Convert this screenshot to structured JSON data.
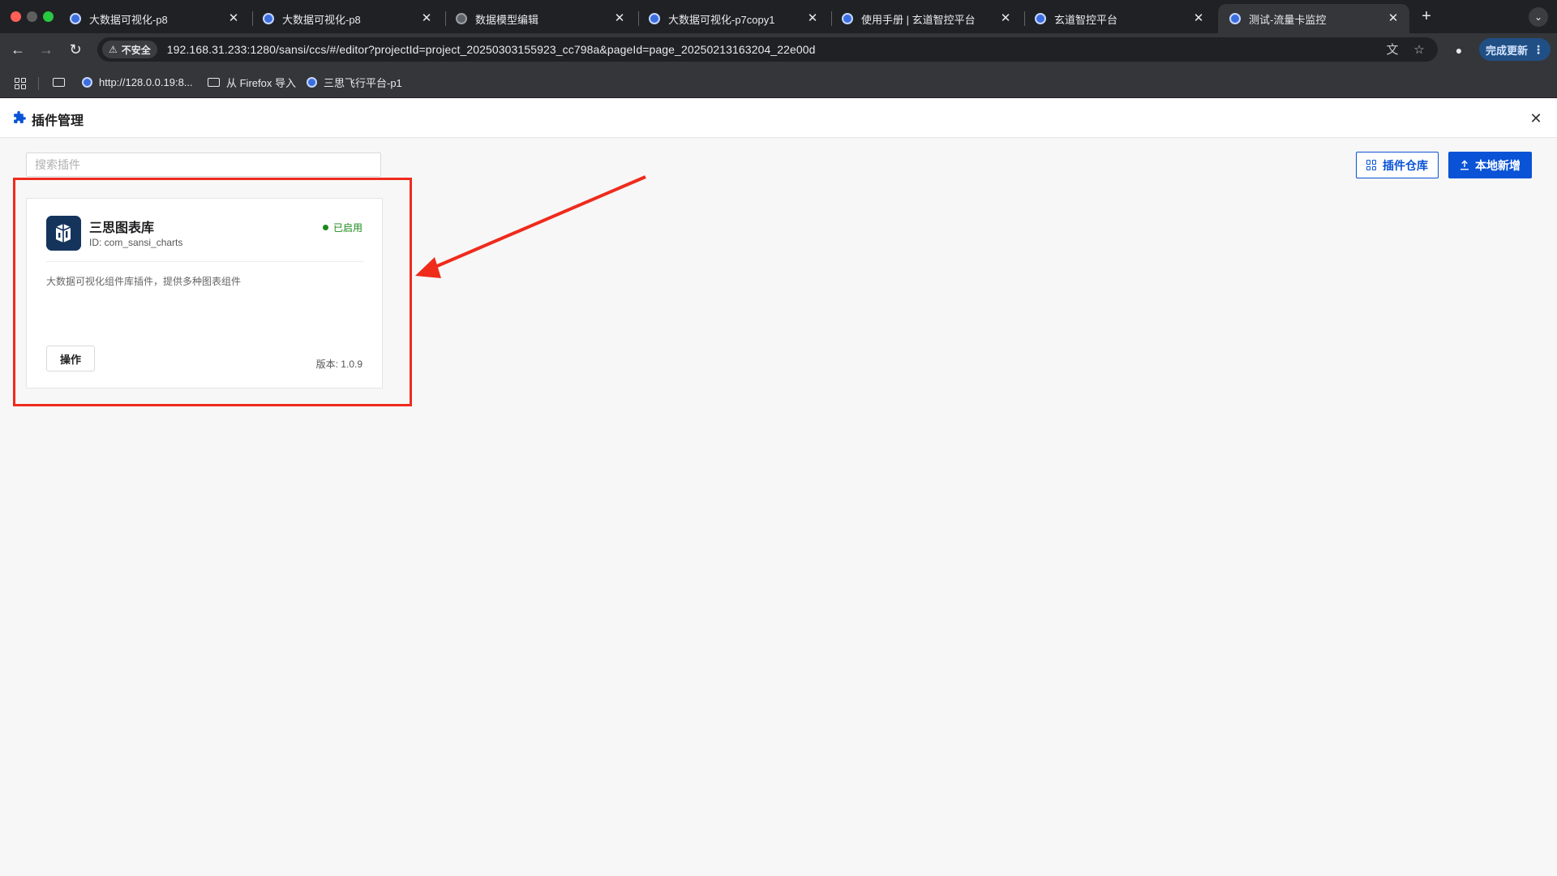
{
  "browser": {
    "tabs": [
      {
        "title": "大数据可视化-p8",
        "active": false,
        "icon": "site-favicon"
      },
      {
        "title": "大数据可视化-p8",
        "active": false,
        "icon": "site-favicon"
      },
      {
        "title": "数据模型编辑",
        "active": false,
        "icon": "globe-icon"
      },
      {
        "title": "大数据可视化-p7copy1",
        "active": false,
        "icon": "site-favicon"
      },
      {
        "title": "使用手册 | 玄道智控平台",
        "active": false,
        "icon": "site-favicon"
      },
      {
        "title": "玄道智控平台",
        "active": false,
        "icon": "site-favicon"
      },
      {
        "title": "测试-流量卡监控",
        "active": true,
        "icon": "site-favicon"
      }
    ],
    "security_label": "不安全",
    "url": "192.168.31.233:1280/sansi/ccs/#/editor?projectId=project_20250303155923_cc798a&pageId=page_20250213163204_22e00d",
    "update_label": "完成更新",
    "bookmarks": [
      {
        "label": "http://128.0.0.19:8...",
        "icon": "site-favicon"
      },
      {
        "label": "从 Firefox 导入",
        "icon": "folder-icon"
      },
      {
        "label": "三思飞行平台-p1",
        "icon": "site-favicon"
      }
    ]
  },
  "page": {
    "title": "插件管理",
    "search_placeholder": "搜索插件",
    "repo_button": "插件仓库",
    "add_button": "本地新增"
  },
  "plugins": [
    {
      "name": "三思图表库",
      "id_text": "ID: com_sansi_charts",
      "status": "已启用",
      "description": "大数据可视化组件库插件，提供多种图表组件",
      "action_label": "操作",
      "version_text": "版本: 1.0.9"
    }
  ],
  "colors": {
    "accent": "#0a53d6",
    "enabled": "#1a8a1a",
    "annotation": "#ef2b1c",
    "chrome_dark": "#202124",
    "chrome_toolbar": "#35363a"
  }
}
